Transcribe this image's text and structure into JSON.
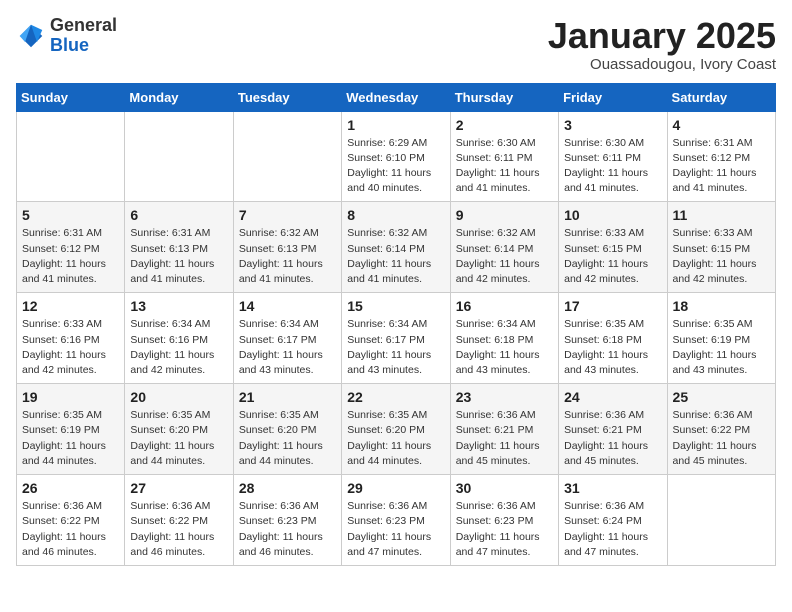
{
  "logo": {
    "general": "General",
    "blue": "Blue"
  },
  "header": {
    "month": "January 2025",
    "location": "Ouassadougou, Ivory Coast"
  },
  "weekdays": [
    "Sunday",
    "Monday",
    "Tuesday",
    "Wednesday",
    "Thursday",
    "Friday",
    "Saturday"
  ],
  "weeks": [
    [
      {
        "day": "",
        "info": ""
      },
      {
        "day": "",
        "info": ""
      },
      {
        "day": "",
        "info": ""
      },
      {
        "day": "1",
        "info": "Sunrise: 6:29 AM\nSunset: 6:10 PM\nDaylight: 11 hours\nand 40 minutes."
      },
      {
        "day": "2",
        "info": "Sunrise: 6:30 AM\nSunset: 6:11 PM\nDaylight: 11 hours\nand 41 minutes."
      },
      {
        "day": "3",
        "info": "Sunrise: 6:30 AM\nSunset: 6:11 PM\nDaylight: 11 hours\nand 41 minutes."
      },
      {
        "day": "4",
        "info": "Sunrise: 6:31 AM\nSunset: 6:12 PM\nDaylight: 11 hours\nand 41 minutes."
      }
    ],
    [
      {
        "day": "5",
        "info": "Sunrise: 6:31 AM\nSunset: 6:12 PM\nDaylight: 11 hours\nand 41 minutes."
      },
      {
        "day": "6",
        "info": "Sunrise: 6:31 AM\nSunset: 6:13 PM\nDaylight: 11 hours\nand 41 minutes."
      },
      {
        "day": "7",
        "info": "Sunrise: 6:32 AM\nSunset: 6:13 PM\nDaylight: 11 hours\nand 41 minutes."
      },
      {
        "day": "8",
        "info": "Sunrise: 6:32 AM\nSunset: 6:14 PM\nDaylight: 11 hours\nand 41 minutes."
      },
      {
        "day": "9",
        "info": "Sunrise: 6:32 AM\nSunset: 6:14 PM\nDaylight: 11 hours\nand 42 minutes."
      },
      {
        "day": "10",
        "info": "Sunrise: 6:33 AM\nSunset: 6:15 PM\nDaylight: 11 hours\nand 42 minutes."
      },
      {
        "day": "11",
        "info": "Sunrise: 6:33 AM\nSunset: 6:15 PM\nDaylight: 11 hours\nand 42 minutes."
      }
    ],
    [
      {
        "day": "12",
        "info": "Sunrise: 6:33 AM\nSunset: 6:16 PM\nDaylight: 11 hours\nand 42 minutes."
      },
      {
        "day": "13",
        "info": "Sunrise: 6:34 AM\nSunset: 6:16 PM\nDaylight: 11 hours\nand 42 minutes."
      },
      {
        "day": "14",
        "info": "Sunrise: 6:34 AM\nSunset: 6:17 PM\nDaylight: 11 hours\nand 43 minutes."
      },
      {
        "day": "15",
        "info": "Sunrise: 6:34 AM\nSunset: 6:17 PM\nDaylight: 11 hours\nand 43 minutes."
      },
      {
        "day": "16",
        "info": "Sunrise: 6:34 AM\nSunset: 6:18 PM\nDaylight: 11 hours\nand 43 minutes."
      },
      {
        "day": "17",
        "info": "Sunrise: 6:35 AM\nSunset: 6:18 PM\nDaylight: 11 hours\nand 43 minutes."
      },
      {
        "day": "18",
        "info": "Sunrise: 6:35 AM\nSunset: 6:19 PM\nDaylight: 11 hours\nand 43 minutes."
      }
    ],
    [
      {
        "day": "19",
        "info": "Sunrise: 6:35 AM\nSunset: 6:19 PM\nDaylight: 11 hours\nand 44 minutes."
      },
      {
        "day": "20",
        "info": "Sunrise: 6:35 AM\nSunset: 6:20 PM\nDaylight: 11 hours\nand 44 minutes."
      },
      {
        "day": "21",
        "info": "Sunrise: 6:35 AM\nSunset: 6:20 PM\nDaylight: 11 hours\nand 44 minutes."
      },
      {
        "day": "22",
        "info": "Sunrise: 6:35 AM\nSunset: 6:20 PM\nDaylight: 11 hours\nand 44 minutes."
      },
      {
        "day": "23",
        "info": "Sunrise: 6:36 AM\nSunset: 6:21 PM\nDaylight: 11 hours\nand 45 minutes."
      },
      {
        "day": "24",
        "info": "Sunrise: 6:36 AM\nSunset: 6:21 PM\nDaylight: 11 hours\nand 45 minutes."
      },
      {
        "day": "25",
        "info": "Sunrise: 6:36 AM\nSunset: 6:22 PM\nDaylight: 11 hours\nand 45 minutes."
      }
    ],
    [
      {
        "day": "26",
        "info": "Sunrise: 6:36 AM\nSunset: 6:22 PM\nDaylight: 11 hours\nand 46 minutes."
      },
      {
        "day": "27",
        "info": "Sunrise: 6:36 AM\nSunset: 6:22 PM\nDaylight: 11 hours\nand 46 minutes."
      },
      {
        "day": "28",
        "info": "Sunrise: 6:36 AM\nSunset: 6:23 PM\nDaylight: 11 hours\nand 46 minutes."
      },
      {
        "day": "29",
        "info": "Sunrise: 6:36 AM\nSunset: 6:23 PM\nDaylight: 11 hours\nand 47 minutes."
      },
      {
        "day": "30",
        "info": "Sunrise: 6:36 AM\nSunset: 6:23 PM\nDaylight: 11 hours\nand 47 minutes."
      },
      {
        "day": "31",
        "info": "Sunrise: 6:36 AM\nSunset: 6:24 PM\nDaylight: 11 hours\nand 47 minutes."
      },
      {
        "day": "",
        "info": ""
      }
    ]
  ]
}
